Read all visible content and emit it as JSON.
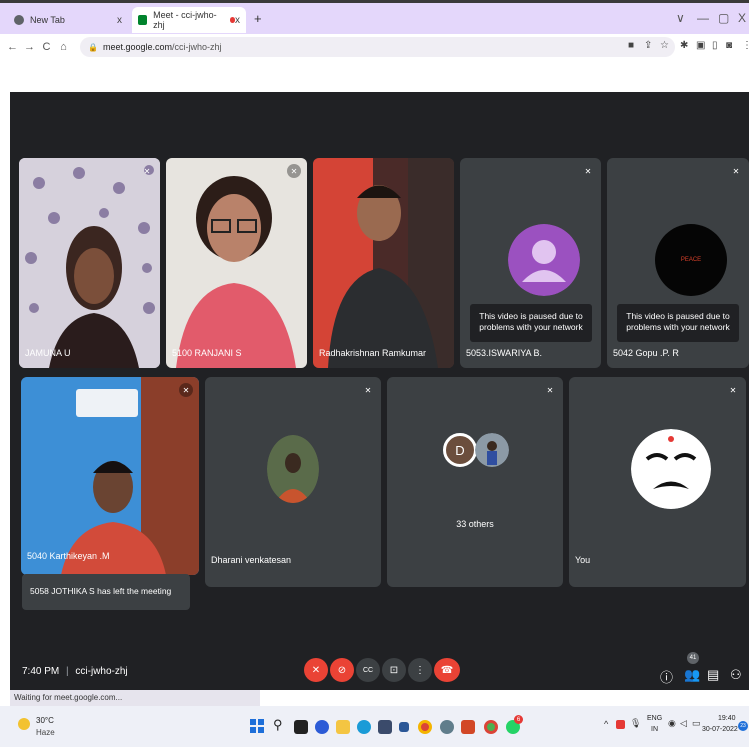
{
  "browser": {
    "tabs": [
      {
        "title": "New Tab",
        "close": "x"
      },
      {
        "title": "Meet - cci-jwho-zhj",
        "close": "x"
      }
    ],
    "new_tab": "+",
    "url_host": "meet.google.com",
    "url_path": "/cci-jwho-zhj",
    "window_controls": {
      "dropdown": "∨",
      "minimize": "—",
      "restore": "▢",
      "close": "X"
    },
    "status_text": "Waiting for meet.google.com..."
  },
  "meeting": {
    "time": "7:40 PM",
    "separator": "|",
    "code": "cci-jwho-zhj",
    "people_count": "41",
    "tiles": [
      {
        "name": "JAMUNA U"
      },
      {
        "name": "5100 RANJANI S"
      },
      {
        "name": "Radhakrishnan Ramkumar"
      },
      {
        "name": "5053.ISWARIYA B.",
        "paused": "This video is paused due to problems with your network"
      },
      {
        "name": "5042 Gopu .P. R",
        "paused": "This video is paused due to problems with your network",
        "avatar_text": "PEACE"
      },
      {
        "name": "5040 Karthikeyan .M"
      },
      {
        "name": "Dharani venkatesan"
      },
      {
        "name": "33 others",
        "avatar_letter": "D"
      },
      {
        "name": "You"
      }
    ],
    "toast": "5058 JOTHIKA S has left the meeting"
  },
  "taskbar": {
    "temp": "30°C",
    "weather": "Haze",
    "lang_top": "ENG",
    "lang_bottom": "IN",
    "time": "19:40",
    "date": "30-07-2022",
    "notif": "23",
    "badge": "6"
  }
}
